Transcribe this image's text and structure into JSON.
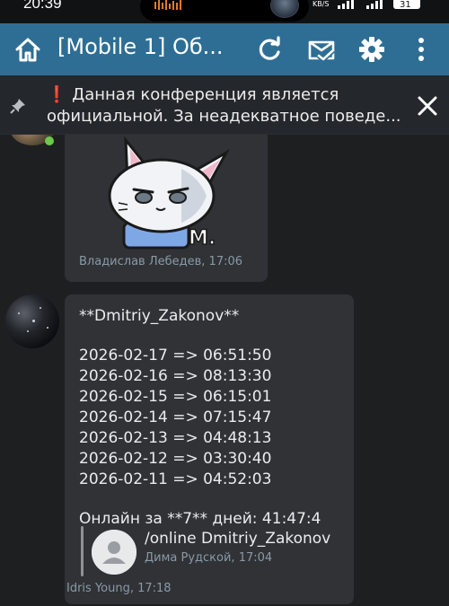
{
  "status_bar": {
    "time": "20:39",
    "net_speed": "KB/S",
    "battery": "31"
  },
  "app_bar": {
    "title": "[Mobile 1] Об...",
    "icons": [
      "home-icon",
      "refresh-icon",
      "mark-read-icon",
      "settings-icon",
      "more-icon"
    ]
  },
  "pinned": {
    "icon": "pin-icon",
    "emoji": "❗",
    "text": "Данная конференция является официальной. За неадекватное поведе...",
    "close_icon": "close-icon"
  },
  "messages": [
    {
      "type": "sticker",
      "sticker_caption": "M.",
      "author": "Владислав Лебедев",
      "time": "17:06",
      "meta": "Владислав Лебедев, 17:06"
    },
    {
      "type": "text",
      "lines": [
        "**Dmitriy_Zakonov**",
        "",
        "2026-02-17 => 06:51:50",
        "2026-02-16 => 08:13:30",
        "2026-02-15 => 06:15:01",
        "2026-02-14 => 07:15:47",
        "2026-02-13 => 04:48:13",
        "2026-02-12 => 03:30:40",
        "2026-02-11 => 04:52:03",
        "",
        "Онлайн за **7** дней: 41:47:4"
      ],
      "reply": {
        "text": "/online Dmitriy_Zakonov",
        "meta": "Дима Рудской, 17:04"
      },
      "meta": "Idris Young, 17:18"
    }
  ],
  "colors": {
    "app_bar": "#2e6e94",
    "background": "#1e1f21",
    "bubble": "#303236",
    "banner": "#24272b",
    "meta_text": "#8a9aa6"
  }
}
